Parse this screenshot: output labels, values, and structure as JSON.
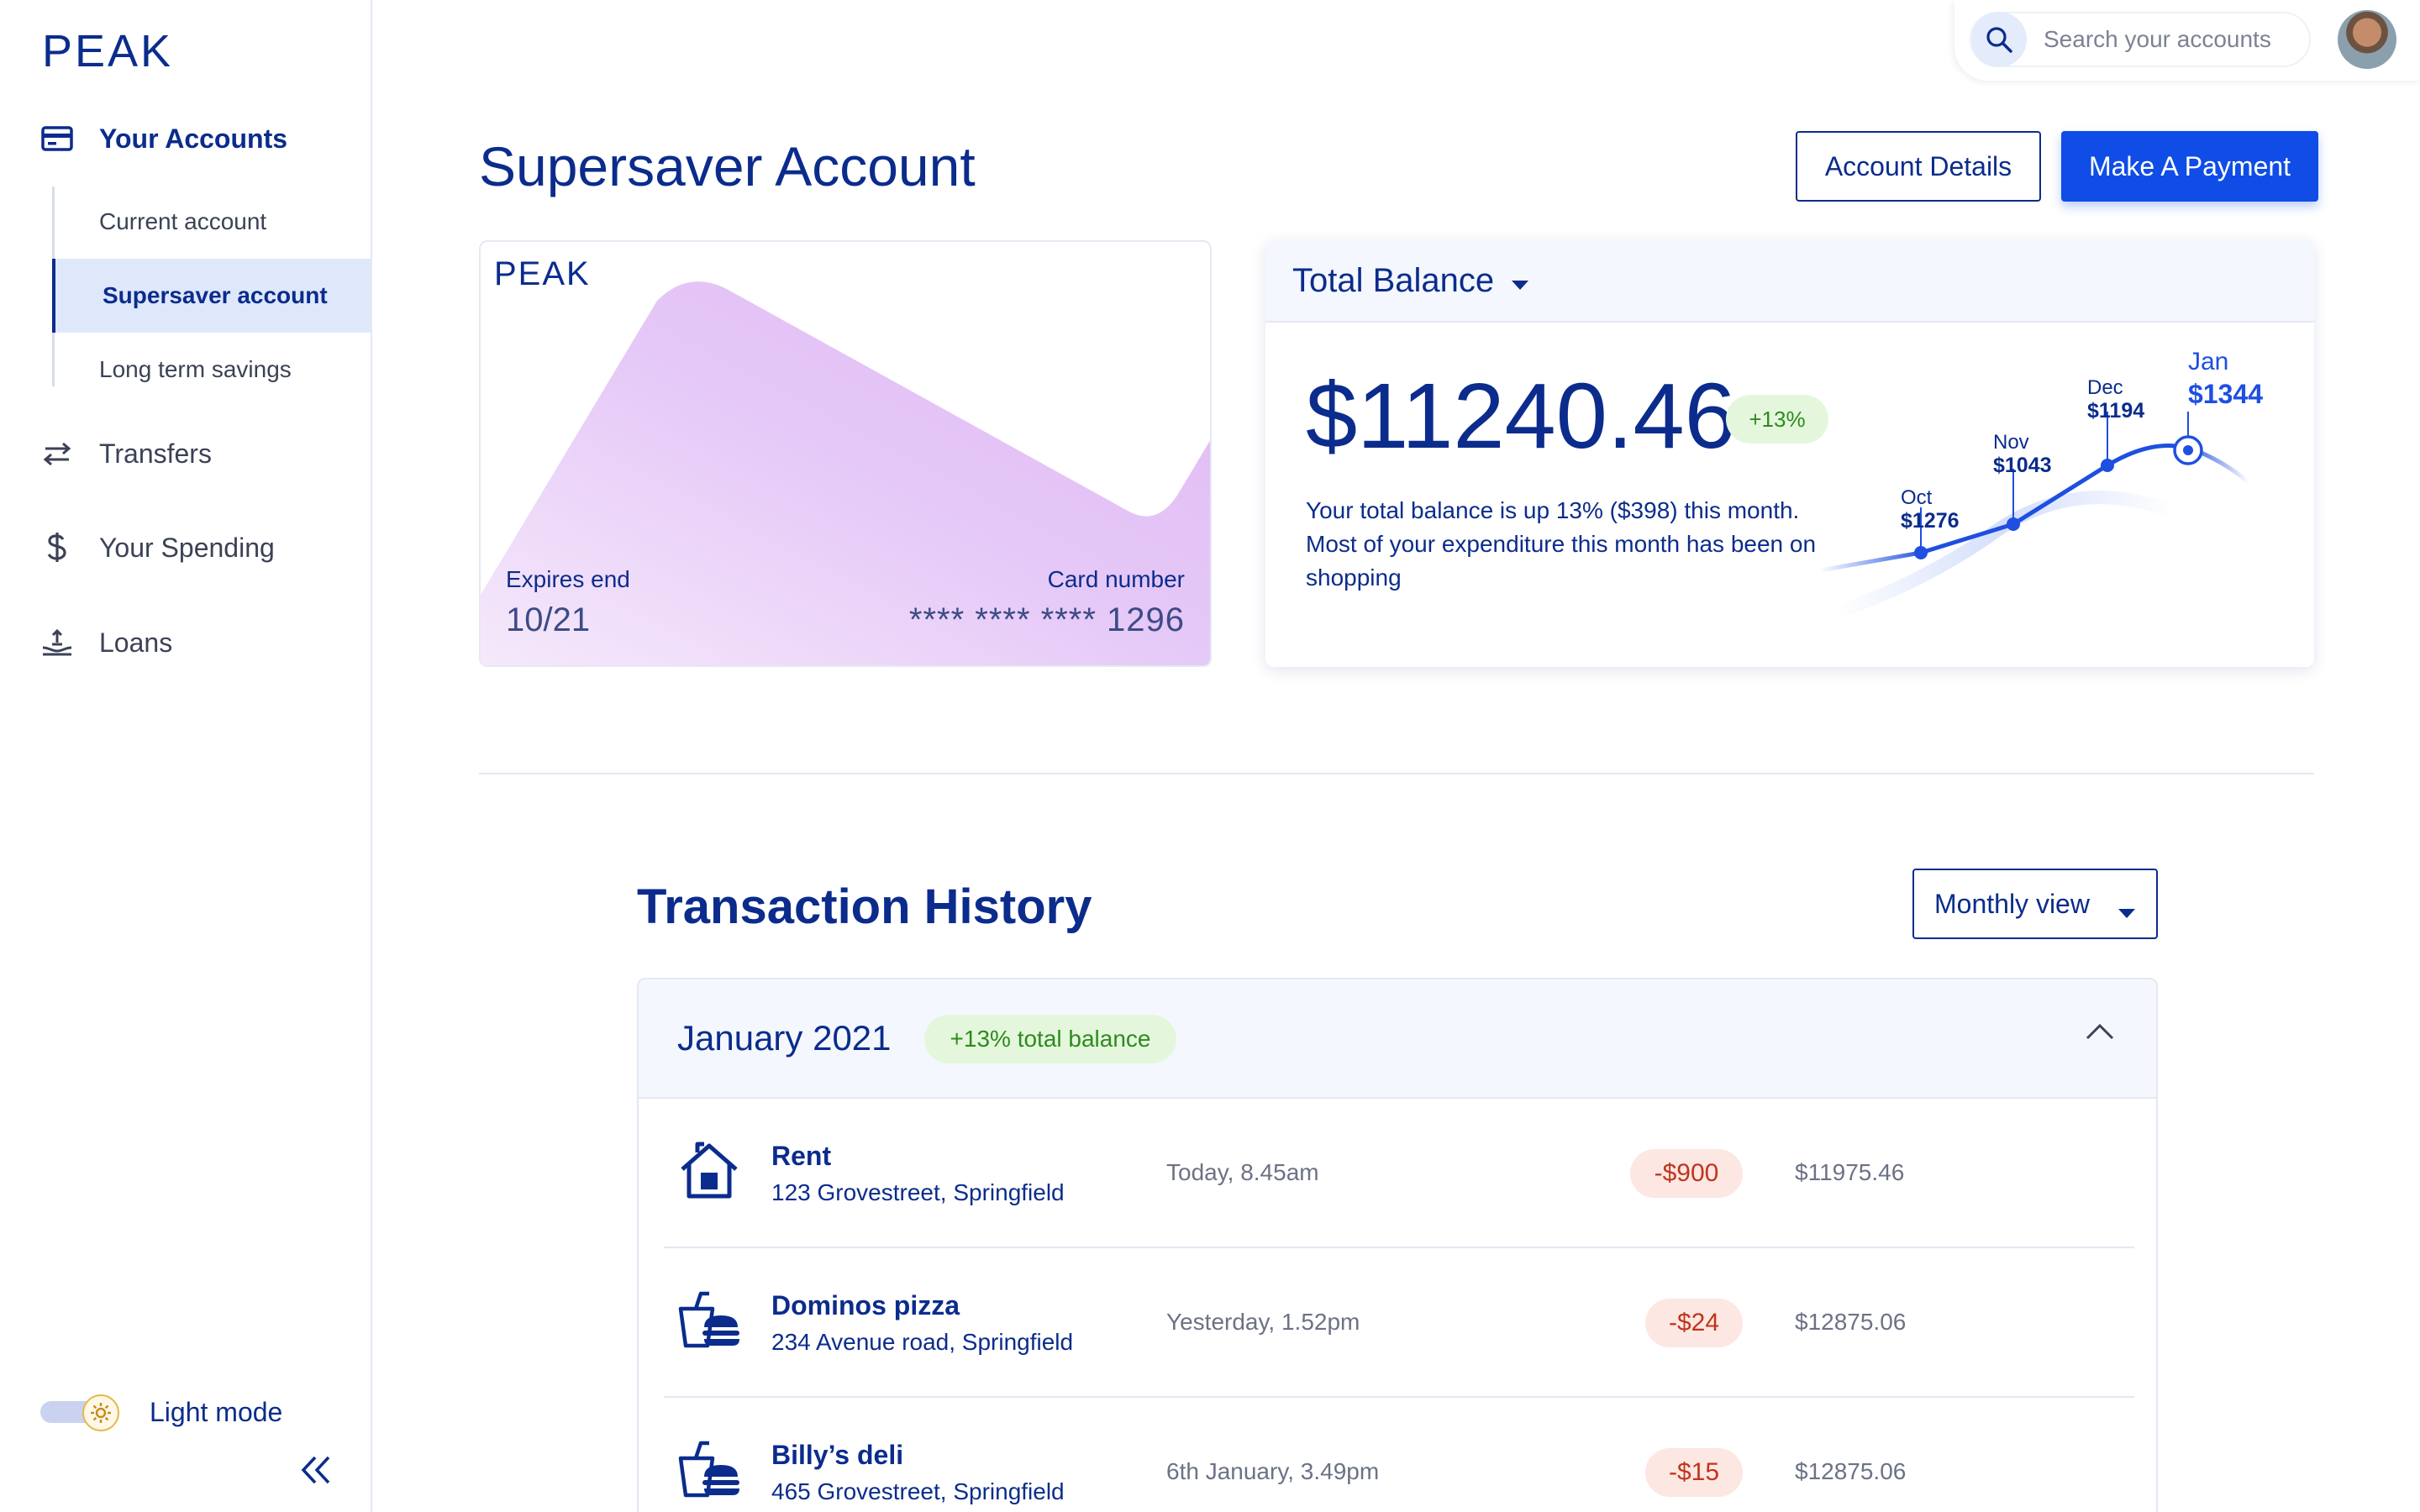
{
  "brand": {
    "logo": "PEAK"
  },
  "sidebar": {
    "accounts_label": "Your Accounts",
    "sub_items": [
      {
        "label": "Current account"
      },
      {
        "label": "Supersaver account"
      },
      {
        "label": "Long term savings"
      }
    ],
    "transfers_label": "Transfers",
    "spending_label": "Your Spending",
    "loans_label": "Loans",
    "mode_label": "Light mode"
  },
  "search": {
    "placeholder": "Search your accounts"
  },
  "header": {
    "title": "Supersaver Account",
    "account_details_label": "Account Details",
    "payment_label": "Make A Payment"
  },
  "card": {
    "logo": "PEAK",
    "expires_label": "Expires end",
    "expires_value": "10/21",
    "number_label": "Card number",
    "number_value": "**** **** **** 1296"
  },
  "balance": {
    "header_label": "Total Balance",
    "amount": "$11240.46",
    "change_badge": "+13%",
    "summary": "Your total balance is up 13% ($398) this month. Most of your expenditure this month has been on shopping",
    "chart_points": [
      {
        "month": "Oct",
        "value": "$1276"
      },
      {
        "month": "Nov",
        "value": "$1043"
      },
      {
        "month": "Dec",
        "value": "$1194"
      },
      {
        "month": "Jan",
        "value": "$1344"
      }
    ]
  },
  "transactions": {
    "title": "Transaction History",
    "view_label": "Monthly view",
    "month": "January 2021",
    "month_badge": "+13% total balance",
    "rows": [
      {
        "name": "Rent",
        "address": "123 Grovestreet, Springfield",
        "time": "Today, 8.45am",
        "amount": "-$900",
        "balance": "$11975.46",
        "icon": "house-icon"
      },
      {
        "name": "Dominos pizza",
        "address": "234 Avenue road, Springfield",
        "time": "Yesterday, 1.52pm",
        "amount": "-$24",
        "balance": "$12875.06",
        "icon": "fast-food-icon"
      },
      {
        "name": "Billy’s deli",
        "address": "465 Grovestreet, Springfield",
        "time": "6th January, 3.49pm",
        "amount": "-$15",
        "balance": "$12875.06",
        "icon": "fast-food-icon"
      }
    ]
  },
  "colors": {
    "brand": "#0b2c8c",
    "accent": "#0f4de6",
    "positive": "#2f8a1e",
    "negative": "#c0341d"
  }
}
